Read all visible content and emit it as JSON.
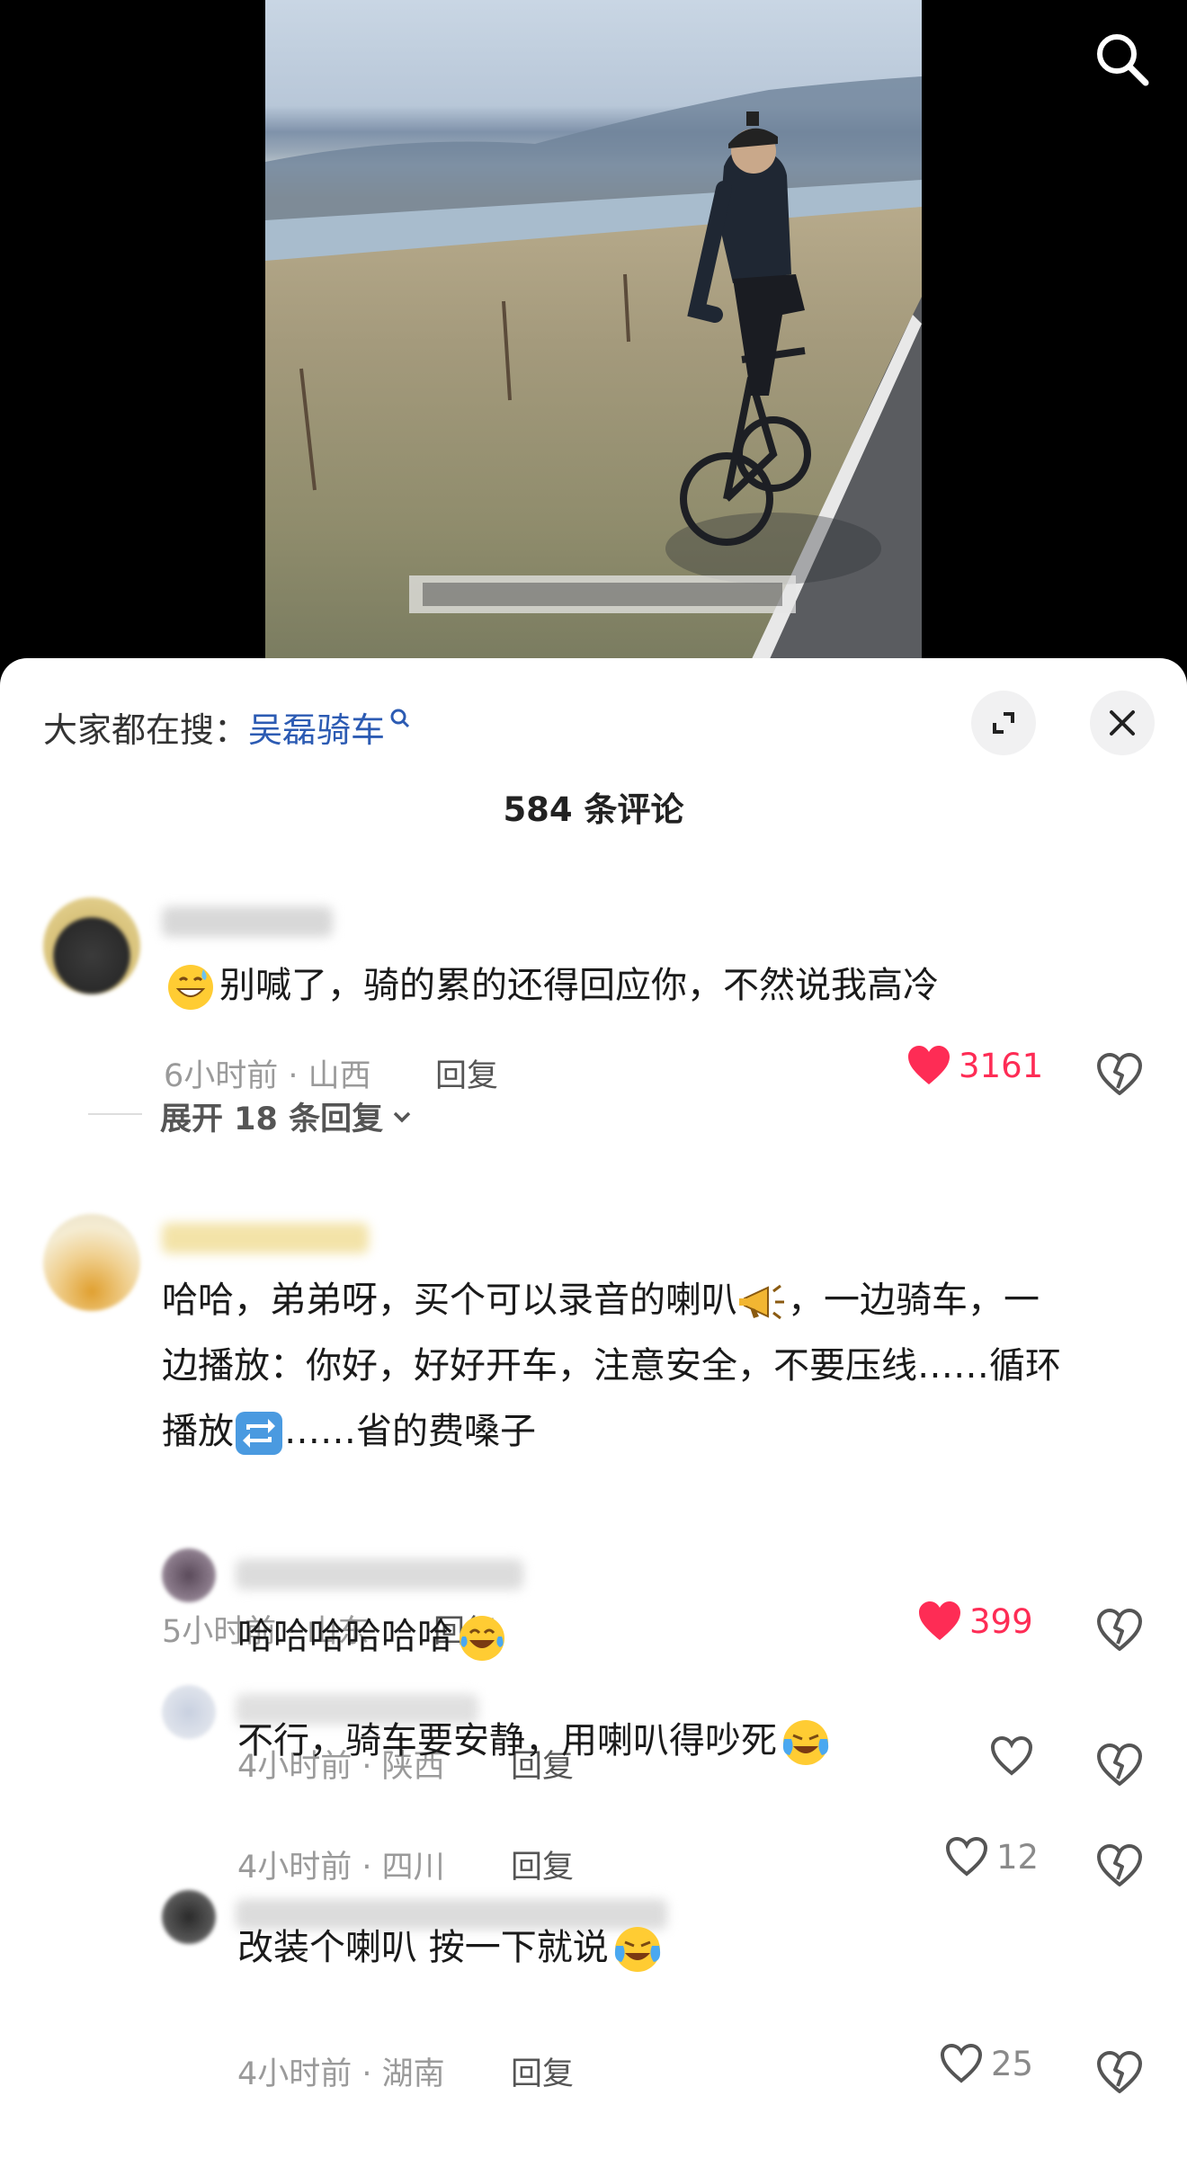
{
  "search": {
    "label": "大家都在搜：",
    "term": "吴磊骑车"
  },
  "comment_count": "584 条评论",
  "reply_label": "回复",
  "comments": [
    {
      "text": "别喊了，骑的累的还得回应你，不然说我高冷",
      "time": "6小时前 · 山西",
      "likes": "3161",
      "liked": true,
      "expand": "展开 18 条回复"
    },
    {
      "text_line1": "哈哈，弟弟呀，买个可以录音的喇叭",
      "text_line1b": "，一边骑车，一",
      "text_line2": "边播放：你好，好好开车，注意安全，不要压线……循环",
      "text_line3a": "播放",
      "text_line3b": "……省的费嗓子",
      "time": "5小时前 · 山东",
      "likes": "399",
      "liked": true
    }
  ],
  "replies": [
    {
      "text": "哈哈哈哈哈哈",
      "time": "4小时前 · 陕西",
      "likes": ""
    },
    {
      "text": "不行，骑车要安静，用喇叭得吵死",
      "time": "4小时前 · 四川",
      "likes": "12"
    },
    {
      "text": "改装个喇叭 按一下就说",
      "time": "4小时前 · 湖南",
      "likes": "25"
    }
  ],
  "colors": {
    "like_red": "#fe2c55",
    "search_blue": "#2c5bb3"
  }
}
